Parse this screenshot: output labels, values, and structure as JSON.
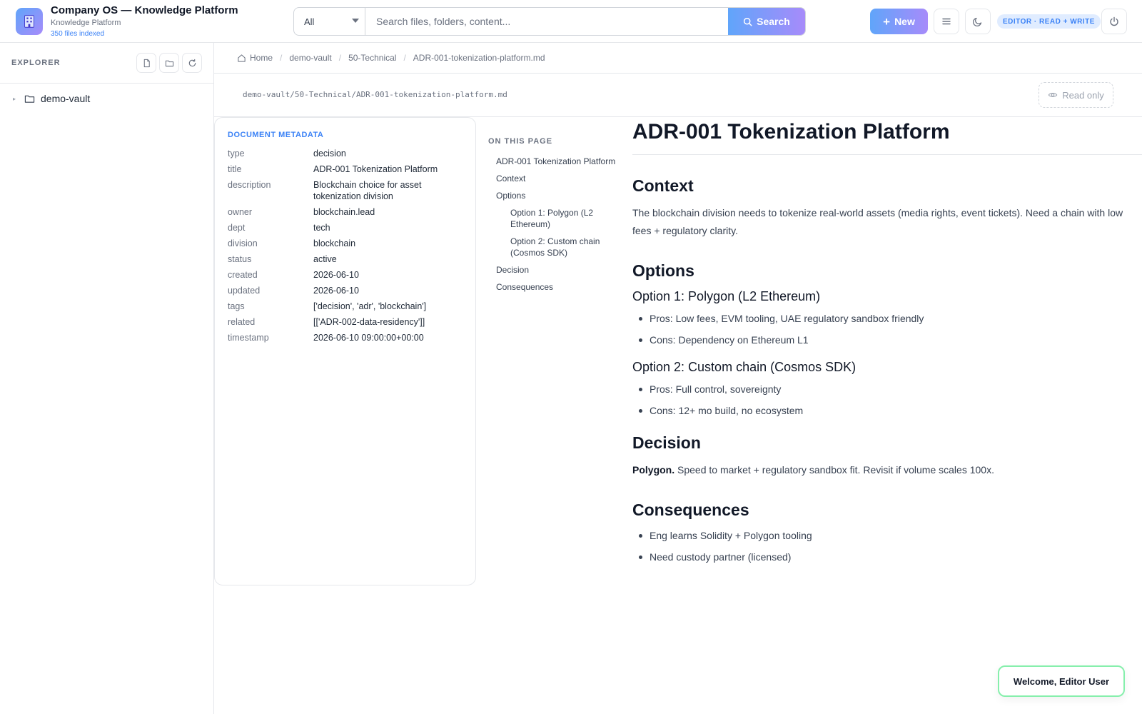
{
  "header": {
    "title": "Company OS — Knowledge Platform",
    "subtitle": "Knowledge Platform",
    "files_indexed": "350 files indexed",
    "logo_icon": "building-icon"
  },
  "search": {
    "scope": "All",
    "placeholder": "Search files, folders, content...",
    "button_label": "Search"
  },
  "toolbar": {
    "new_label": "New",
    "role_badge": "EDITOR · READ + WRITE"
  },
  "sidebar": {
    "title": "EXPLORER",
    "tree": [
      {
        "label": "demo-vault",
        "icon": "folder-icon"
      }
    ]
  },
  "breadcrumb": {
    "items": [
      "Home",
      "demo-vault",
      "50-Technical",
      "ADR-001-tokenization-platform.md"
    ]
  },
  "file": {
    "path": "demo-vault/50-Technical/ADR-001-tokenization-platform.md",
    "mode_label": "Read only"
  },
  "metadata": {
    "title": "DOCUMENT METADATA",
    "rows": [
      {
        "key": "type",
        "value": "decision"
      },
      {
        "key": "title",
        "value": "ADR-001 Tokenization Platform"
      },
      {
        "key": "description",
        "value": "Blockchain choice for asset tokenization division"
      },
      {
        "key": "owner",
        "value": "blockchain.lead"
      },
      {
        "key": "dept",
        "value": "tech"
      },
      {
        "key": "division",
        "value": "blockchain"
      },
      {
        "key": "status",
        "value": "active"
      },
      {
        "key": "created",
        "value": "2026-06-10"
      },
      {
        "key": "updated",
        "value": "2026-06-10"
      },
      {
        "key": "tags",
        "value": "['decision', 'adr', 'blockchain']"
      },
      {
        "key": "related",
        "value": "[['ADR-002-data-residency']]"
      },
      {
        "key": "timestamp",
        "value": "2026-06-10 09:00:00+00:00"
      }
    ]
  },
  "toc": {
    "title": "ON THIS PAGE",
    "items": [
      {
        "label": "ADR-001 Tokenization Platform",
        "level": 1
      },
      {
        "label": "Context",
        "level": 1
      },
      {
        "label": "Options",
        "level": 1
      },
      {
        "label": "Option 1: Polygon (L2 Ethereum)",
        "level": 2
      },
      {
        "label": "Option 2: Custom chain (Cosmos SDK)",
        "level": 2
      },
      {
        "label": "Decision",
        "level": 1
      },
      {
        "label": "Consequences",
        "level": 1
      }
    ]
  },
  "document": {
    "h1": "ADR-001 Tokenization Platform",
    "context_heading": "Context",
    "context_text": "The blockchain division needs to tokenize real-world assets (media rights, event tickets). Need a chain with low fees + regulatory clarity.",
    "options_heading": "Options",
    "option1_heading": "Option 1: Polygon (L2 Ethereum)",
    "option1_items": [
      "Pros: Low fees, EVM tooling, UAE regulatory sandbox friendly",
      "Cons: Dependency on Ethereum L1"
    ],
    "option2_heading": "Option 2: Custom chain (Cosmos SDK)",
    "option2_items": [
      "Pros: Full control, sovereignty",
      "Cons: 12+ mo build, no ecosystem"
    ],
    "decision_heading": "Decision",
    "decision_bold": "Polygon.",
    "decision_text": " Speed to market + regulatory sandbox fit. Revisit if volume scales 100x.",
    "consequences_heading": "Consequences",
    "consequences_items": [
      "Eng learns Solidity + Polygon tooling",
      "Need custody partner (licensed)"
    ]
  },
  "toast": {
    "message": "Welcome, Editor User"
  }
}
